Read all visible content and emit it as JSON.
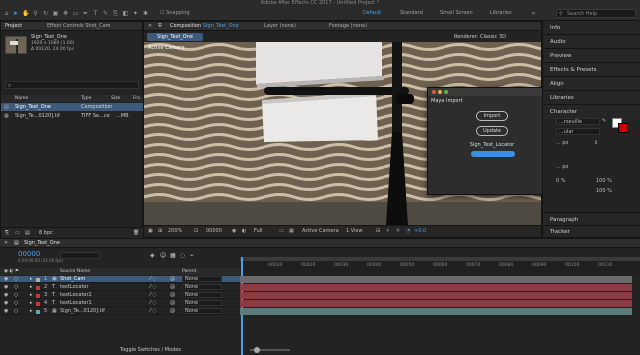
{
  "app": {
    "title": "Adobe After Effects CC 2017 - Untitled Project *"
  },
  "toolbar": {
    "snapping": "Snapping",
    "workspaces": [
      "Default",
      "Standard",
      "Small Screen",
      "Libraries"
    ],
    "active_workspace": "Default",
    "search_placeholder": "Search Help"
  },
  "project_panel": {
    "tab": "Project",
    "effect_tab": "Effect Controls Shot_Cam",
    "preview": {
      "name": "Sign_Test_One",
      "dims": "1920 x 1080 (1.00)",
      "duration": "Δ 00120, 24.00 fps"
    },
    "search_placeholder": "⌕",
    "headers": {
      "name": "Name",
      "type": "Type",
      "size": "Size",
      "fr": "Fra"
    },
    "items": [
      {
        "name": "Sign_Test_One",
        "type": "Composition",
        "size": "",
        "fr": "",
        "selected": true
      },
      {
        "name": "Sign_Te...0120].tif",
        "type": "TIFF Se...ce",
        "size": "...MB",
        "fr": "",
        "selected": false
      }
    ],
    "bpc": "8 bpc"
  },
  "composition": {
    "tab": "Composition",
    "tab_name": "Sign_Test_One",
    "layer_tab": "Layer (none)",
    "footage_tab": "Footage (none)",
    "comp_chip": "Sign_Test_One",
    "renderer_label": "Renderer:",
    "renderer": "Classic 3D",
    "camera_label": "Active Camera"
  },
  "viewer_bar": {
    "zoom": "200%",
    "timecode": "00000",
    "resolution": "Full",
    "view": "Active Camera",
    "views": "1 View",
    "exposure": "+0.0"
  },
  "maya_import": {
    "title": "Maya Import",
    "import_label": "Import",
    "update_label": "Update",
    "locator_label": "Sign_Test_Locator",
    "progress": 1.0
  },
  "right_panel": {
    "items": [
      "Info",
      "Audio",
      "Preview",
      "Effects & Presets",
      "Align",
      "Libraries",
      "Character",
      "Paragraph",
      "Tracker"
    ],
    "character": {
      "font": "...rseuille",
      "style": "...ular",
      "size": "... px",
      "percent1": "100 %",
      "percent2": "100 %",
      "px2": "... px",
      "val1": "0 %"
    }
  },
  "timeline": {
    "tab": "Sign_Test_One",
    "timecode": "00000",
    "timecode_sub": "0:00:00:00 (24.00 fps)",
    "col_source": "Source Name",
    "col_parent": "Parent",
    "ruler": [
      "00010",
      "00020",
      "00030",
      "00040",
      "00050",
      "00060",
      "00070",
      "00080",
      "00090",
      "00100",
      "00110"
    ],
    "layers": [
      {
        "num": "1",
        "name": "Shot_Cam",
        "parent": "None",
        "color": "#b1b1b1",
        "track": "#6b6b6b",
        "selected": true
      },
      {
        "num": "2",
        "name": "textLocator",
        "parent": "None",
        "color": "#c23b3b",
        "track": "#8a3c44",
        "selected": false
      },
      {
        "num": "3",
        "name": "textLocator2",
        "parent": "None",
        "color": "#c23b3b",
        "track": "#8a3c44",
        "selected": false
      },
      {
        "num": "4",
        "name": "textLocator1",
        "parent": "None",
        "color": "#c23b3b",
        "track": "#8a3c44",
        "selected": false
      },
      {
        "num": "5",
        "name": "Sign_Te...0120].tif",
        "parent": "None",
        "color": "#6aa6a6",
        "track": "#5d7b7b",
        "selected": false
      }
    ],
    "toggle_label": "Toggle Switches / Modes"
  },
  "colors": {
    "accent": "#4a9ee8",
    "maya_bar": "#3b8fe5"
  }
}
